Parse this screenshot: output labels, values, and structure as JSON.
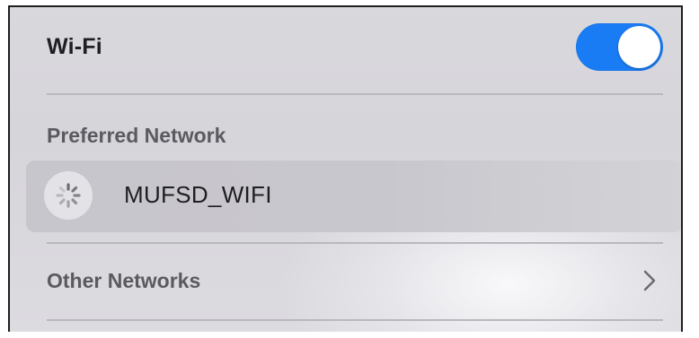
{
  "wifi": {
    "title": "Wi-Fi",
    "enabled": true,
    "toggle_color": "#1a7cf5"
  },
  "preferred": {
    "header": "Preferred Network",
    "network": {
      "name": "MUFSD_WIFI",
      "status_icon": "loading-spinner-icon"
    }
  },
  "other": {
    "label": "Other Networks",
    "icon": "chevron-right-icon"
  }
}
